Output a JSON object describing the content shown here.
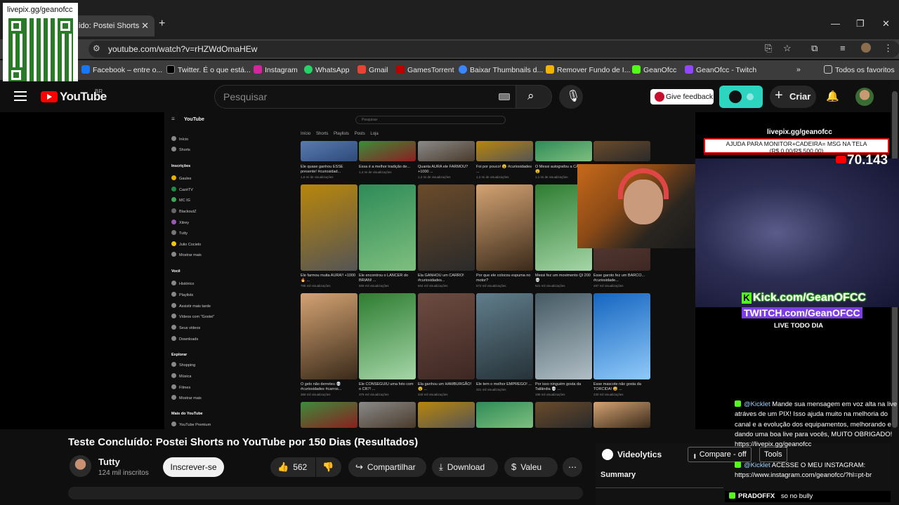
{
  "browser": {
    "tab_title": "ido: Postei Shorts",
    "url": "youtube.com/watch?v=rHZWdOmaHEw",
    "bookmarks": [
      "Facebook – entre o...",
      "Twitter. É o que está...",
      "Instagram",
      "WhatsApp",
      "Gmail",
      "GamesTorrent",
      "Baixar Thumbnails d...",
      "Remover Fundo de I...",
      "GeanOfcc",
      "GeanOfcc - Twitch"
    ],
    "all_bookmarks": "Todos os favoritos"
  },
  "overlay": {
    "qr_label": "livepix.gg/geanofcc",
    "stream_url": "livepix.gg/geanofcc",
    "goal_title": "AJUDA PARA MONITOR+CADEIRA= MSG NA TELA",
    "goal_amount": "(R$ 0,00/R$ 500,00)",
    "viewer_count": "70.143",
    "kick": "Kick.com/GeanOFCC",
    "twitch": "TWITCH.com/GeanOFCC",
    "live_daily": "LIVE TODO DIA"
  },
  "youtube": {
    "logo": "YouTube",
    "region": "BR",
    "search_placeholder": "Pesquisar",
    "feedback": "Give feedback",
    "create": "Criar"
  },
  "inner": {
    "search": "Pesquisar",
    "tabs": "Início Shorts Playlists Posts Loja",
    "sidebar": [
      "Início",
      "Shorts",
      "Inscrições",
      "Gaules",
      "CazéTV",
      "MC IG",
      "BlackoutZ",
      "Xitrey",
      "Tutty",
      "Julio Cocielo",
      "Mostrar mais",
      "Você",
      "Histórico",
      "Playlists",
      "Assistir mais tarde",
      "Vídeos com \"Gostei\"",
      "Seus vídeos",
      "Downloads",
      "Explorar",
      "Shopping",
      "Música",
      "Filmes",
      "Mostrar mais",
      "Mais do YouTube",
      "YouTube Premium"
    ],
    "row1": [
      {
        "title": "Ele quase ganhou ESSE presente! #curiosidad...",
        "views": "1,5 mi de visualizações"
      },
      {
        "title": "Essa é a melhor tradição de...",
        "views": "1,4 mi de visualizações"
      },
      {
        "title": "Quanta AURA ele FARMOU? +1000 ...",
        "views": "1,2 mi de visualizações"
      },
      {
        "title": "Foi por pouco! 😮 #curiosidades ...",
        "views": "1,2 mi de visualizações"
      },
      {
        "title": "O Messi autografou a CÂMERA! 😮",
        "views": "1,1 mi de visualizações"
      }
    ],
    "row2": [
      {
        "title": "Ele farmou muita AURA!! +1000 🔥 ...",
        "views": "786 mil visualizações"
      },
      {
        "title": "Ele encontrou o LANCER do BRIAN! ...",
        "views": "559 mil visualizações"
      },
      {
        "title": "Ela GANHOU um CARRO! #curiosidades...",
        "views": "604 mil visualizações"
      },
      {
        "title": "Por que ele colocou espuma no motor?",
        "views": "572 mil visualizações"
      },
      {
        "title": "Messi fez um movimento QI 200 💀",
        "views": "521 mil visualizações"
      },
      {
        "title": "Esse garoto fez um BARCO... #curiosidade...",
        "views": "497 mil visualizações"
      }
    ],
    "row3": [
      {
        "title": "O gelo não derreteu 💀 #curiosidades #carros...",
        "views": "368 mil visualizações"
      },
      {
        "title": "Ele CONSEGUIU uma foto com o CR7! ...",
        "views": "379 mil visualizações"
      },
      {
        "title": "Ela ganhou um HAMBURGÃO! 😮 ...",
        "views": "340 mil visualizações"
      },
      {
        "title": "Ele tem o melhor EMPREGO! ...",
        "views": "321 mil visualizações"
      },
      {
        "title": "Por isso ninguém gosta da Tailândia 💀 ...",
        "views": "198 mil visualizações"
      },
      {
        "title": "Esse mascote não gosta da TORCIDA! 😅 ...",
        "views": "230 mil visualizações"
      }
    ]
  },
  "video": {
    "title": "Teste Concluído: Postei Shorts no YouTube por 150 Dias (Resultados)",
    "channel": "Tutty",
    "subscribers": "124 mil inscritos",
    "subscribe": "Inscrever-se",
    "likes": "562",
    "share": "Compartilhar",
    "download": "Download",
    "thanks": "Valeu"
  },
  "chat": [
    {
      "user": "@Kicklet",
      "text": "Mande sua mensagem em voz alta na live atráves de um PIX! Isso ajuda muito na melhoria do canal e a evolução dos equipamentos, melhorando e dando uma boa live para vocês, MUITO OBRIGADO! https://livepix.gg/geanofcc"
    },
    {
      "user": "@Kicklet",
      "text": "ACESSE O MEU INSTAGRAM: https://www.instagram.com/geanofcc/?hl=pt-br"
    },
    {
      "user": "PRADOFFX",
      "text": "so no bully"
    }
  ],
  "videolytics": {
    "title": "Videolytics",
    "compare": "Compare - off",
    "tools": "Tools",
    "summary": "Summary"
  },
  "colors": {
    "youtube_red": "#ff0000",
    "kick_green": "#53fc18",
    "twitch_purple": "#7b3fe4",
    "extension_teal": "#2dd4bf"
  }
}
